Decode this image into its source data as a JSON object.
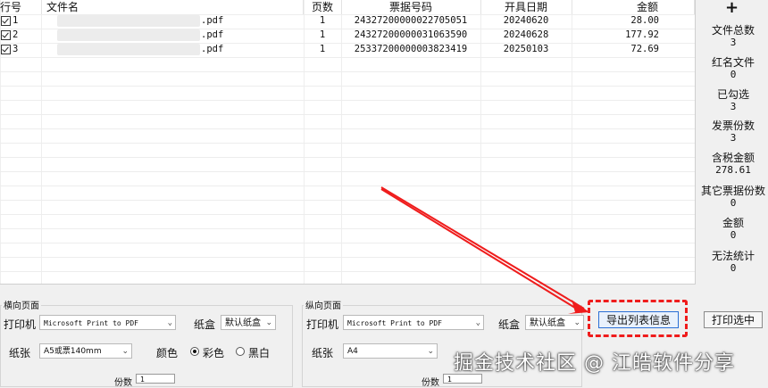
{
  "table": {
    "headers": [
      "行号",
      "文件名",
      "页数",
      "票据号码",
      "开具日期",
      "金额"
    ],
    "rows": [
      {
        "row": "1",
        "file_suffix": ".pdf",
        "pages": "1",
        "invoice_no": "24327200000022705051",
        "date": "20240620",
        "amount": "28.00"
      },
      {
        "row": "2",
        "file_suffix": ".pdf",
        "pages": "1",
        "invoice_no": "24327200000031063590",
        "date": "20240628",
        "amount": "177.92"
      },
      {
        "row": "3",
        "file_suffix": ".pdf",
        "pages": "1",
        "invoice_no": "25337200000003823419",
        "date": "20250103",
        "amount": "72.69"
      }
    ]
  },
  "sidebar": {
    "add": "+",
    "stats": [
      {
        "label": "文件总数",
        "value": "3"
      },
      {
        "label": "红名文件",
        "value": "0"
      },
      {
        "label": "已勾选",
        "value": "3"
      },
      {
        "label": "发票份数",
        "value": "3"
      },
      {
        "label": "含税金额",
        "value": "278.61"
      },
      {
        "label": "其它票据份数",
        "value": "0"
      },
      {
        "label": "金额",
        "value": "0"
      },
      {
        "label": "无法统计",
        "value": "0"
      }
    ]
  },
  "landscape": {
    "title": "横向页面",
    "printer_label": "打印机",
    "printer_value": "Microsoft Print to PDF",
    "tray_label": "纸盒",
    "tray_value": "默认纸盒",
    "paper_label": "纸张",
    "paper_value": "A5或票140mm",
    "color_label": "颜色",
    "color_option": "彩色",
    "bw_option": "黑白",
    "copies_label": "份数",
    "copies_value": "1"
  },
  "portrait": {
    "title": "纵向页面",
    "printer_label": "打印机",
    "printer_value": "Microsoft Print to PDF",
    "tray_label": "纸盒",
    "tray_value": "默认纸盒",
    "paper_label": "纸张",
    "paper_value": "A4",
    "copies_label": "份数",
    "copies_value": "1"
  },
  "actions": {
    "export": "导出列表信息",
    "print_selected": "打印选中"
  },
  "watermark": "掘金技术社区 @ 江皓软件分享",
  "colors": {
    "annotation": "#ef1c1c"
  }
}
